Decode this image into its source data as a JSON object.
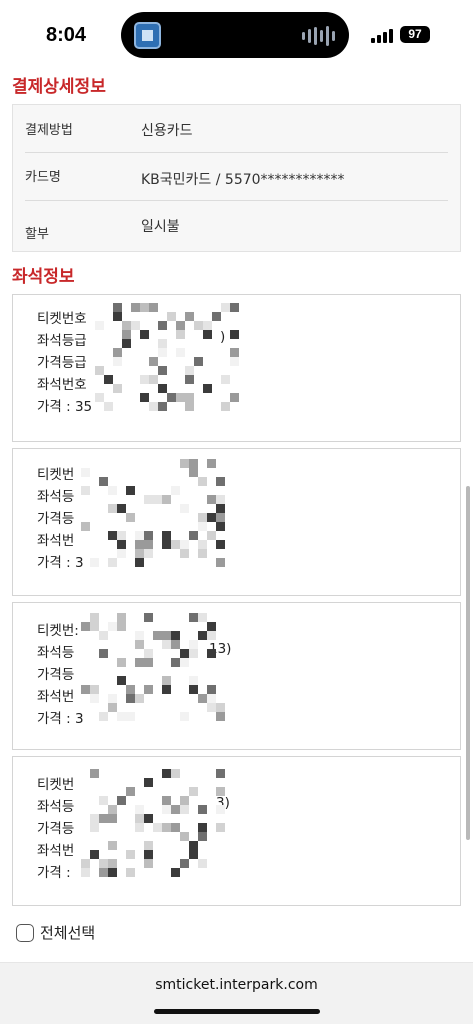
{
  "status_bar": {
    "time": "8:04",
    "battery": "97"
  },
  "payment": {
    "title": "결제상세정보",
    "rows": [
      {
        "label": "결제방법",
        "value": "신용카드"
      },
      {
        "label": "카드명",
        "value": "KB국민카드 / 5570************"
      },
      {
        "label": "할부",
        "value": "일시불"
      }
    ]
  },
  "seat_info": {
    "title": "좌석정보",
    "tickets": [
      {
        "lines": [
          "티켓번호",
          "좌석등급",
          "가격등급",
          "좌석번호",
          "가격 : 35"
        ],
        "suffix": ")"
      },
      {
        "lines": [
          "티켓번",
          "좌석등",
          "가격등",
          "좌석번",
          "가격 : 3"
        ],
        "suffix": ""
      },
      {
        "lines": [
          "티켓번:",
          "좌석등",
          "가격등",
          "좌석번",
          "가격 : 3"
        ],
        "suffix": "13)"
      },
      {
        "lines": [
          "티켓번",
          "좌석등",
          "가격등",
          "좌석번",
          "가격 :"
        ],
        "suffix": "3)"
      }
    ]
  },
  "select_all": {
    "label": "전체선택"
  },
  "browser": {
    "url": "smticket.interpark.com"
  }
}
